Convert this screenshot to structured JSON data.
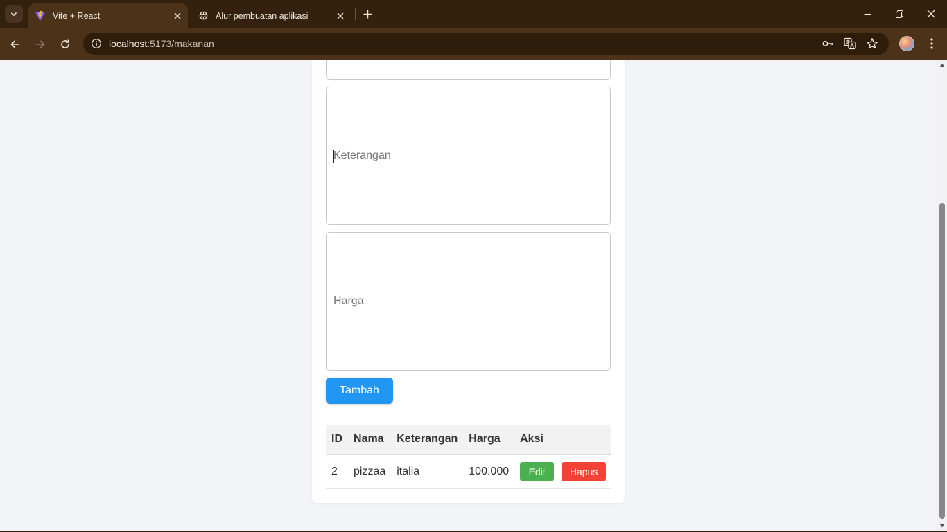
{
  "browser": {
    "tabs": [
      {
        "title": "Vite + React",
        "icon": "vite-icon",
        "active": true
      },
      {
        "title": "Alur pembuatan aplikasi",
        "icon": "openai-icon",
        "active": false
      }
    ],
    "url_host": "localhost",
    "url_path": ":5173/makanan"
  },
  "form": {
    "keterangan_placeholder": "Keterangan",
    "harga_placeholder": "Harga",
    "submit_label": "Tambah"
  },
  "table": {
    "headers": [
      "ID",
      "Nama",
      "Keterangan",
      "Harga",
      "Aksi"
    ],
    "rows": [
      {
        "id": "2",
        "nama": "pizzaa",
        "keterangan": "italia",
        "harga": "100.000",
        "edit_label": "Edit",
        "delete_label": "Hapus"
      }
    ]
  },
  "colors": {
    "primary_button": "#2196f3",
    "edit_button": "#4caf50",
    "delete_button": "#f44336",
    "page_background": "#f3f4f8"
  }
}
